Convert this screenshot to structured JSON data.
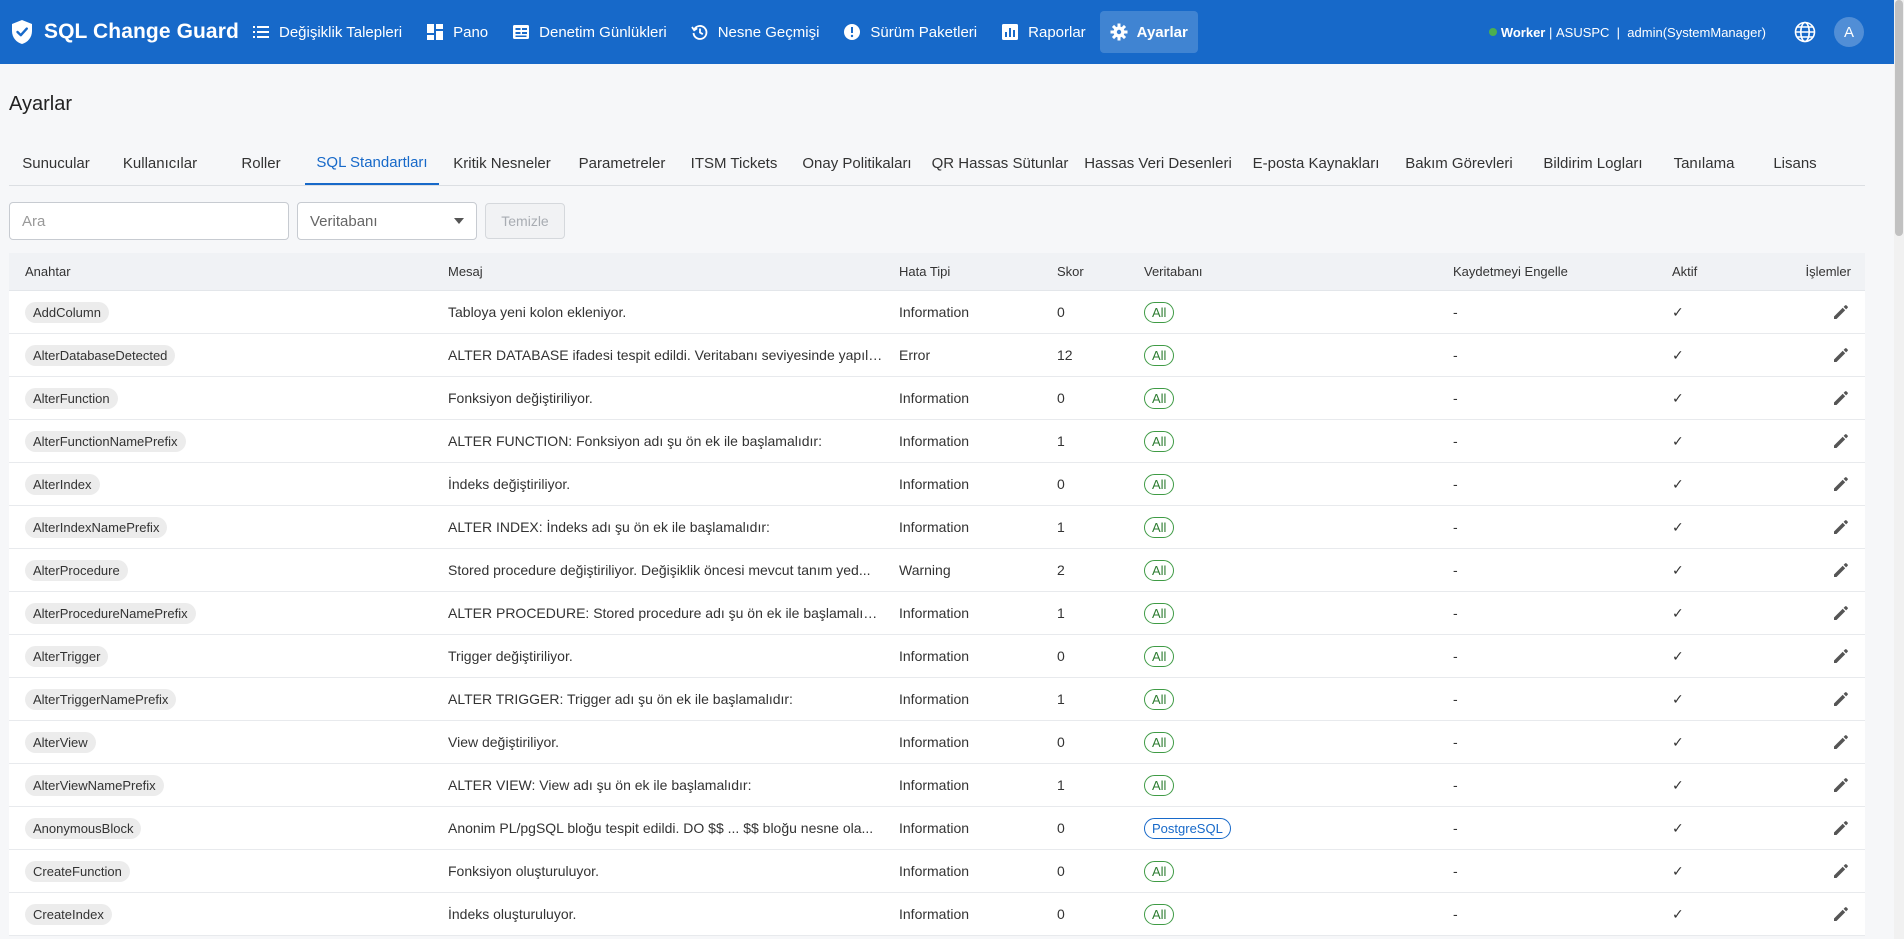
{
  "app": {
    "name": "SQL Change Guard",
    "brand_color": "#1769c9"
  },
  "nav": [
    {
      "label": "Değişiklik Talepleri",
      "icon": "list-icon"
    },
    {
      "label": "Pano",
      "icon": "dashboard-icon"
    },
    {
      "label": "Denetim Günlükleri",
      "icon": "audit-log-icon"
    },
    {
      "label": "Nesne Geçmişi",
      "icon": "history-icon"
    },
    {
      "label": "Sürüm Paketleri",
      "icon": "package-icon"
    },
    {
      "label": "Raporlar",
      "icon": "bar-chart-icon"
    },
    {
      "label": "Ayarlar",
      "icon": "gear-icon",
      "active": true
    }
  ],
  "header_right": {
    "worker_label": "Worker",
    "machine": "ASUSPC",
    "user": "admin(SystemManager)",
    "avatar_letter": "A"
  },
  "page": {
    "title": "Ayarlar"
  },
  "tabs": [
    {
      "label": "Sunucular"
    },
    {
      "label": "Kullanıcılar"
    },
    {
      "label": "Roller"
    },
    {
      "label": "SQL Standartları",
      "active": true
    },
    {
      "label": "Kritik Nesneler"
    },
    {
      "label": "Parametreler"
    },
    {
      "label": "ITSM Tickets"
    },
    {
      "label": "Onay Politikaları"
    },
    {
      "label": "QR Hassas Sütunlar"
    },
    {
      "label": "Hassas Veri Desenleri"
    },
    {
      "label": "E-posta Kaynakları"
    },
    {
      "label": "Bakım Görevleri"
    },
    {
      "label": "Bildirim Logları"
    },
    {
      "label": "Tanılama"
    },
    {
      "label": "Lisans"
    }
  ],
  "filters": {
    "search_placeholder": "Ara",
    "database_placeholder": "Veritabanı",
    "clear_label": "Temizle"
  },
  "table": {
    "columns": {
      "key": "Anahtar",
      "message": "Mesaj",
      "error_type": "Hata Tipi",
      "score": "Skor",
      "database": "Veritabanı",
      "block_save": "Kaydetmeyi Engelle",
      "active": "Aktif",
      "actions": "İşlemler"
    },
    "rows": [
      {
        "key": "AddColumn",
        "message": "Tabloya yeni kolon ekleniyor.",
        "type": "Information",
        "score": "0",
        "db": "All",
        "block": "-",
        "active": "✓"
      },
      {
        "key": "AlterDatabaseDetected",
        "message": "ALTER DATABASE ifadesi tespit edildi. Veritabanı seviyesinde yapıla...",
        "type": "Error",
        "score": "12",
        "db": "All",
        "block": "-",
        "active": "✓"
      },
      {
        "key": "AlterFunction",
        "message": "Fonksiyon değiştiriliyor.",
        "type": "Information",
        "score": "0",
        "db": "All",
        "block": "-",
        "active": "✓"
      },
      {
        "key": "AlterFunctionNamePrefix",
        "message": "ALTER FUNCTION: Fonksiyon adı şu ön ek ile başlamalıdır:",
        "type": "Information",
        "score": "1",
        "db": "All",
        "block": "-",
        "active": "✓"
      },
      {
        "key": "AlterIndex",
        "message": "İndeks değiştiriliyor.",
        "type": "Information",
        "score": "0",
        "db": "All",
        "block": "-",
        "active": "✓"
      },
      {
        "key": "AlterIndexNamePrefix",
        "message": "ALTER INDEX: İndeks adı şu ön ek ile başlamalıdır:",
        "type": "Information",
        "score": "1",
        "db": "All",
        "block": "-",
        "active": "✓"
      },
      {
        "key": "AlterProcedure",
        "message": "Stored procedure değiştiriliyor. Değişiklik öncesi mevcut tanım yed...",
        "type": "Warning",
        "score": "2",
        "db": "All",
        "block": "-",
        "active": "✓"
      },
      {
        "key": "AlterProcedureNamePrefix",
        "message": "ALTER PROCEDURE: Stored procedure adı şu ön ek ile başlamalıdır:",
        "type": "Information",
        "score": "1",
        "db": "All",
        "block": "-",
        "active": "✓"
      },
      {
        "key": "AlterTrigger",
        "message": "Trigger değiştiriliyor.",
        "type": "Information",
        "score": "0",
        "db": "All",
        "block": "-",
        "active": "✓"
      },
      {
        "key": "AlterTriggerNamePrefix",
        "message": "ALTER TRIGGER: Trigger adı şu ön ek ile başlamalıdır:",
        "type": "Information",
        "score": "1",
        "db": "All",
        "block": "-",
        "active": "✓"
      },
      {
        "key": "AlterView",
        "message": "View değiştiriliyor.",
        "type": "Information",
        "score": "0",
        "db": "All",
        "block": "-",
        "active": "✓"
      },
      {
        "key": "AlterViewNamePrefix",
        "message": "ALTER VIEW: View adı şu ön ek ile başlamalıdır:",
        "type": "Information",
        "score": "1",
        "db": "All",
        "block": "-",
        "active": "✓"
      },
      {
        "key": "AnonymousBlock",
        "message": "Anonim PL/pgSQL bloğu tespit edildi. DO $$ ... $$ bloğu nesne ola...",
        "type": "Information",
        "score": "0",
        "db": "PostgreSQL",
        "block": "-",
        "active": "✓"
      },
      {
        "key": "CreateFunction",
        "message": "Fonksiyon oluşturuluyor.",
        "type": "Information",
        "score": "0",
        "db": "All",
        "block": "-",
        "active": "✓"
      },
      {
        "key": "CreateIndex",
        "message": "İndeks oluşturuluyor.",
        "type": "Information",
        "score": "0",
        "db": "All",
        "block": "-",
        "active": "✓"
      }
    ]
  }
}
